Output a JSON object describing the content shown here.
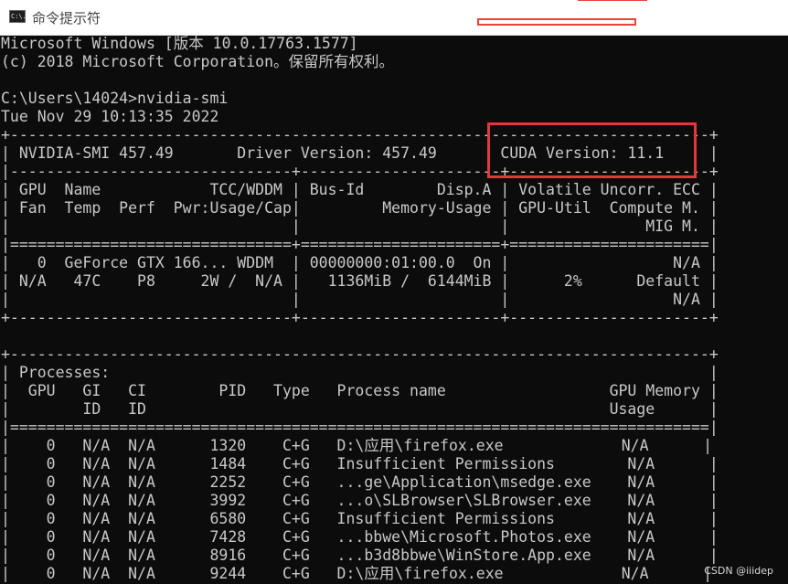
{
  "window": {
    "title": "命令提示符",
    "icon": "console-icon",
    "icon_text": "C:\\."
  },
  "console": {
    "lines": [
      "Microsoft Windows [版本 10.0.17763.1577]",
      "(c) 2018 Microsoft Corporation。保留所有权利。",
      "",
      "C:\\Users\\14024>nvidia-smi",
      "Tue Nov 29 10:13:35 2022",
      "+-----------------------------------------------------------------------------+",
      "| NVIDIA-SMI 457.49       Driver Version: 457.49       CUDA Version: 11.1     |",
      "|-------------------------------+----------------------+----------------------+",
      "| GPU  Name            TCC/WDDM | Bus-Id        Disp.A | Volatile Uncorr. ECC |",
      "| Fan  Temp  Perf  Pwr:Usage/Cap|         Memory-Usage | GPU-Util  Compute M. |",
      "|                               |                      |               MIG M. |",
      "|===============================+======================+======================|",
      "|   0  GeForce GTX 166... WDDM  | 00000000:01:00.0  On |                  N/A |",
      "| N/A   47C    P8     2W /  N/A |   1136MiB /  6144MiB |      2%      Default |",
      "|                               |                      |                  N/A |",
      "+-------------------------------+----------------------+----------------------+",
      "",
      "+-----------------------------------------------------------------------------+",
      "| Processes:                                                                  |",
      "|  GPU   GI   CI        PID   Type   Process name                  GPU Memory |",
      "|        ID   ID                                                   Usage      |",
      "|=============================================================================|",
      "|    0   N/A  N/A      1320    C+G   D:\\应用\\firefox.exe             N/A      |",
      "|    0   N/A  N/A      1484    C+G   Insufficient Permissions        N/A      |",
      "|    0   N/A  N/A      2252    C+G   ...ge\\Application\\msedge.exe    N/A      |",
      "|    0   N/A  N/A      3992    C+G   ...o\\SLBrowser\\SLBrowser.exe    N/A      |",
      "|    0   N/A  N/A      6580    C+G   Insufficient Permissions        N/A      |",
      "|    0   N/A  N/A      7428    C+G   ...bbwe\\Microsoft.Photos.exe    N/A      |",
      "|    0   N/A  N/A      8916    C+G   ...b3d8bbwe\\WinStore.App.exe    N/A      |",
      "|    0   N/A  N/A      9244    C+G   D:\\应用\\firefox.exe             N/A      |"
    ]
  },
  "watermark": "CSDN @iiidep",
  "colors": {
    "console_bg": "#0c0c0c",
    "console_fg": "#c8c8c8",
    "highlight": "#e0393a"
  }
}
